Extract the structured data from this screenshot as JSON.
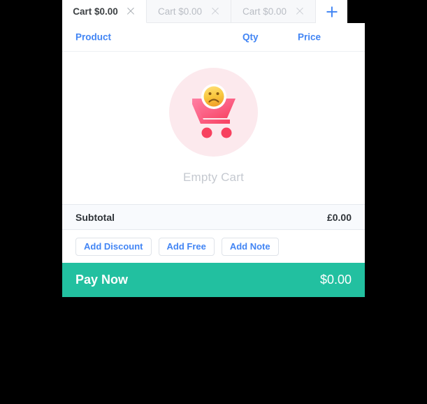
{
  "tabs": [
    {
      "label": "Cart $0.00",
      "active": true,
      "close_icon": "close-icon"
    },
    {
      "label": "Cart $0.00",
      "active": false,
      "close_icon": "close-icon"
    },
    {
      "label": "Cart $0.00",
      "active": false,
      "close_icon": "close-icon"
    }
  ],
  "add_tab": {
    "icon": "plus-icon"
  },
  "columns": {
    "product": "Product",
    "qty": "Qty",
    "price": "Price"
  },
  "empty_state": {
    "label": "Empty Cart",
    "icon": "empty-cart-icon",
    "face_icon": "sad-face-icon",
    "circle_color": "#fce9ed",
    "cart_color_start": "#ff6f91",
    "cart_color_end": "#f94c6e",
    "face_color_start": "#ffd75e",
    "face_color_end": "#f5a623"
  },
  "subtotal": {
    "label": "Subtotal",
    "amount": "£0.00"
  },
  "actions": [
    {
      "label": "Add Discount"
    },
    {
      "label": "Add Free"
    },
    {
      "label": "Add Note"
    }
  ],
  "pay": {
    "label": "Pay Now",
    "amount": "$0.00",
    "color": "#22c0a0"
  },
  "colors": {
    "accent_blue": "#4285f4",
    "teal": "#22c0a0",
    "pink": "#fce9ed",
    "muted_text": "#c5c9d0"
  }
}
